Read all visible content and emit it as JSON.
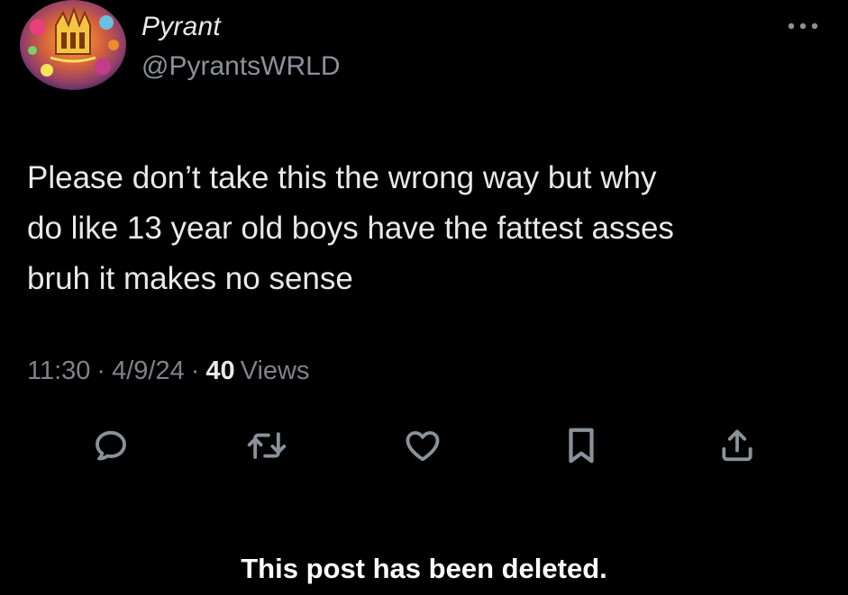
{
  "author": {
    "name": "Pyrant",
    "handle": "@PyrantsWRLD",
    "avatar_icon": "avatar-artwork",
    "avatar_text": "Pyrant"
  },
  "post": {
    "text": "Please don’t take this the wrong way but why\ndo like 13 year old boys have the fattest asses\nbruh it makes no sense",
    "time": "11:30",
    "date": "4/9/24",
    "separator": "·",
    "views_count": "40",
    "views_label": "Views"
  },
  "actions": [
    {
      "name": "reply",
      "icon": "reply-icon"
    },
    {
      "name": "repost",
      "icon": "repost-icon"
    },
    {
      "name": "like",
      "icon": "heart-icon"
    },
    {
      "name": "bookmark",
      "icon": "bookmark-icon"
    },
    {
      "name": "share",
      "icon": "share-icon"
    }
  ],
  "banner": {
    "deleted_text": "This post has been deleted."
  },
  "colors": {
    "background": "#000000",
    "text_primary": "#e7e9ea",
    "text_secondary": "#8b9199",
    "icon": "#8b9199"
  }
}
